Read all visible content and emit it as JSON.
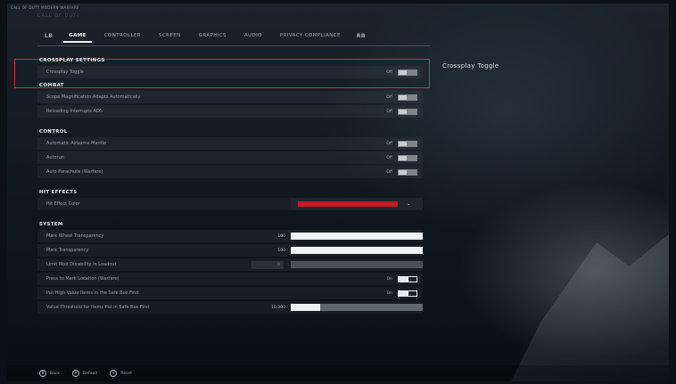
{
  "window_title": "CALL OF DUTY MODERN WARFARE",
  "logo_text": "CALL OF DUTY",
  "tabs": {
    "bumper_left": "LB",
    "bumper_right": "RB",
    "items": [
      "GAME",
      "CONTROLLER",
      "SCREEN",
      "GRAPHICS",
      "AUDIO",
      "PRIVACY COMPLIANCE"
    ],
    "active": "GAME"
  },
  "sections": {
    "crossplay": {
      "title": "CROSSPLAY SETTINGS",
      "rows": [
        {
          "label": "Crossplay Toggle",
          "state": "Off"
        }
      ]
    },
    "combat": {
      "title": "COMBAT",
      "rows": [
        {
          "label": "Scope Magnification Adapts Automatically",
          "state": "Off"
        },
        {
          "label": "Reloading Interrupts ADS",
          "state": "Off"
        }
      ]
    },
    "control": {
      "title": "CONTROL",
      "rows": [
        {
          "label": "Automatic Airborne Mantle",
          "state": "Off"
        },
        {
          "label": "Autorun",
          "state": "Off"
        },
        {
          "label": "Auto Parachute (Warfare)",
          "state": "Off"
        }
      ]
    },
    "hit_effects": {
      "title": "HIT EFFECTS",
      "rows": [
        {
          "label": "Hit Effect Color",
          "value_color": "#c81a22",
          "caret": "⌄"
        }
      ]
    },
    "system": {
      "title": "SYSTEM",
      "rows": [
        {
          "label": "Mark Wheel Transparency",
          "value": "100",
          "level": 1.0
        },
        {
          "label": "Mark Transparency",
          "value": "100",
          "level": 1.0
        },
        {
          "label": "Limit Mod Durability in Loadout",
          "value": "0",
          "level": 0.0
        },
        {
          "label": "Press to Mark Location (Warfare)",
          "state": "On"
        },
        {
          "label": "Put High-Value Items in the Safe Box First",
          "state": "On"
        },
        {
          "label": "Value Threshold for Items Put in Safe Box First",
          "value": "10,000",
          "level": 0.22
        }
      ]
    }
  },
  "detail_panel": {
    "title": "Crossplay Toggle"
  },
  "footer": {
    "items": [
      {
        "icon": "B",
        "label": "Back"
      },
      {
        "icon": "X",
        "label": "Default"
      },
      {
        "icon": "Y",
        "label": "Reset"
      }
    ]
  },
  "colors": {
    "highlight": "#d62a33",
    "hit_color": "#c81a22"
  }
}
